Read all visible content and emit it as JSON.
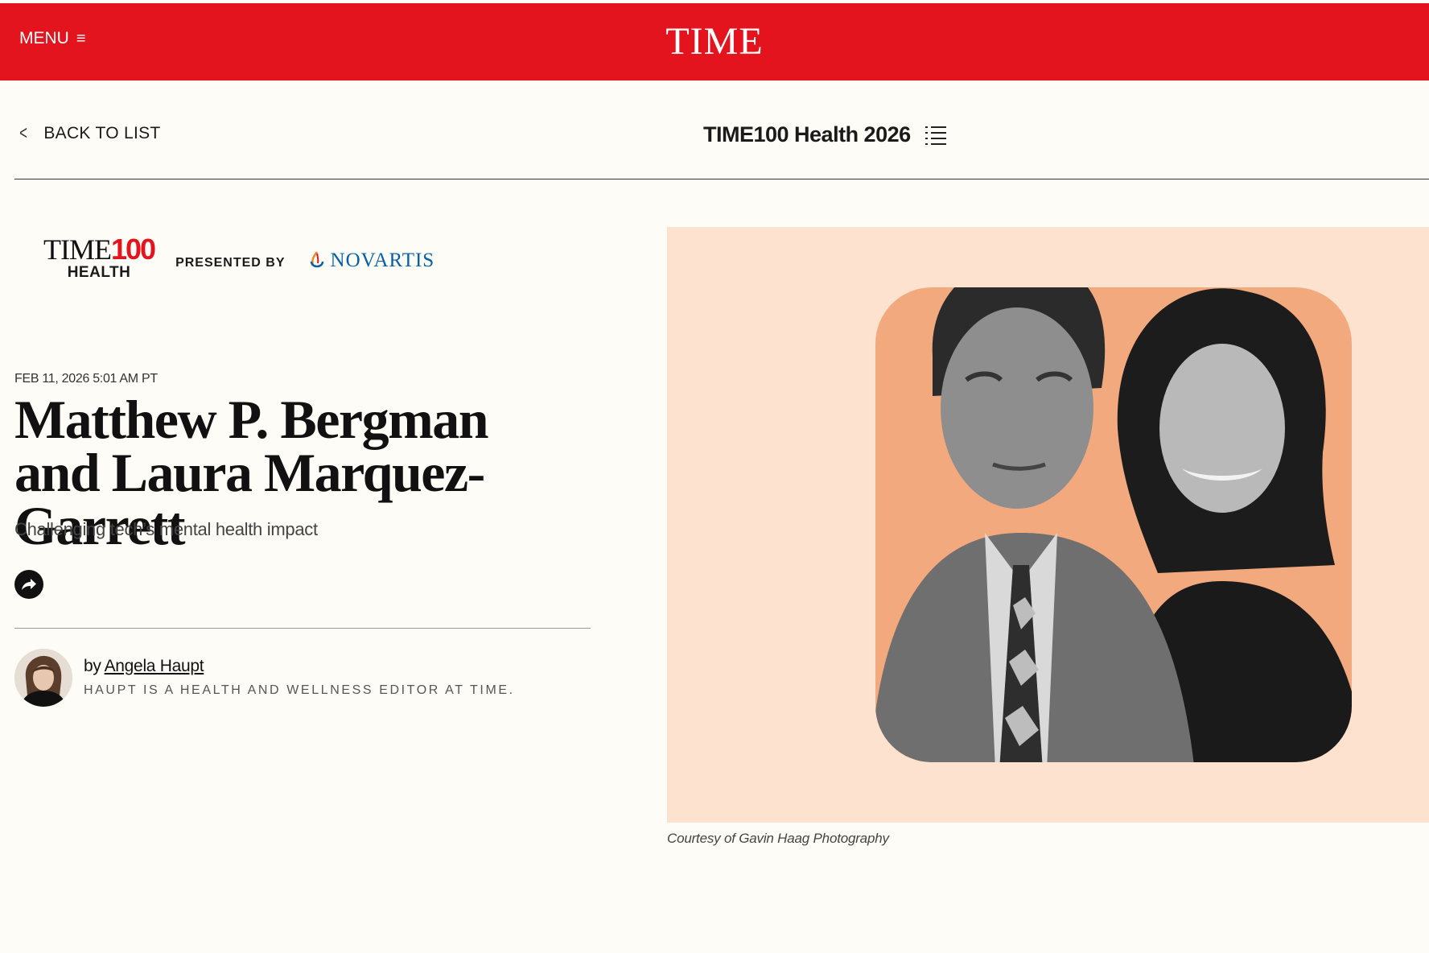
{
  "header": {
    "menu_label": "MENU",
    "menu_icon": "hamburger-icon",
    "logo": "TIME"
  },
  "subnav": {
    "back_label": "BACK TO LIST",
    "list_title": "TIME100 Health 2026"
  },
  "sponsor": {
    "brand_top": "TIME",
    "brand_num": "100",
    "brand_bottom": "HEALTH",
    "presented_by": "PRESENTED BY",
    "sponsor_name": "NOVARTIS"
  },
  "article": {
    "dateline": "FEB 11, 2026 5:01 AM PT",
    "headline": "Matthew P. Bergman and Laura Marquez-Garrett",
    "dek": "Challenging tech’s mental health impact",
    "byline_prefix": "by",
    "author": "Angela Haupt",
    "author_bio": "HAUPT IS A HEALTH AND WELLNESS EDITOR AT TIME.",
    "photo_caption": "Courtesy of Gavin Haag Photography"
  },
  "colors": {
    "brand_red": "#e3141e",
    "page_bg": "#fefcf7",
    "hero_bg": "#fde2d0",
    "hero_card": "#f3a97e",
    "novartis_blue": "#0460a9"
  }
}
